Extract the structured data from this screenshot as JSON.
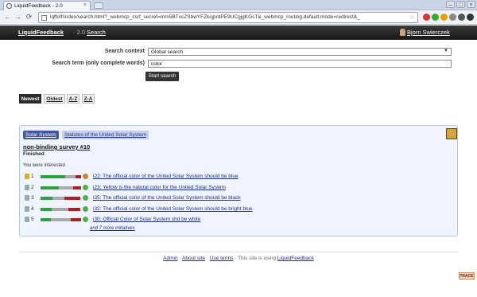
{
  "browser": {
    "tab_title": "LiquidFeedback - 2.0",
    "tab_close": "×",
    "url": "lqfb/lf/index/search.html?_webmcp_csrf_secret=mm5BTxcZSbwYFZksjprdPE9UCgjgKGsT&_webmcp_routing.default.mode=redirect&_",
    "back": "←",
    "forward": "→",
    "reload": "⟳",
    "star": "☆",
    "window_buttons": [
      "–",
      "□",
      "×"
    ]
  },
  "header": {
    "brand": "LiquidFeedback",
    "version": "· 2.0",
    "search_link": "Search",
    "user": "Bjorn Swierczek"
  },
  "search": {
    "context_label": "Search context",
    "context_value": "Global search",
    "term_label": "Search term (only complete words)",
    "term_value": "color",
    "submit": "Start search"
  },
  "sort_tabs": [
    "Newest",
    "Oldest",
    "A-Z",
    "Z-A"
  ],
  "issue": {
    "area": "Solar System",
    "policy": "Statutes of the United Solar System",
    "title": "non-binding survey #10",
    "state": "Finished",
    "interest": "You were interested",
    "initiatives": [
      {
        "rank": "1",
        "label": "i22: The official color of the United Solar System should be blue",
        "yes": 0.62,
        "neutral": 0.25,
        "no": 0.13,
        "winner": true,
        "support_color": "#c8823a"
      },
      {
        "rank": "2",
        "label": "i23: Yellow is the natural color for the United Solar System",
        "yes": 0.45,
        "neutral": 0.35,
        "no": 0.2,
        "winner": false,
        "support_color": "#4fb048"
      },
      {
        "rank": "3",
        "label": "i35: The official color of the United Solar System should be black",
        "yes": 0.3,
        "neutral": 0.3,
        "no": 0.4,
        "winner": false,
        "support_color": "#4fb048"
      },
      {
        "rank": "4",
        "label": "i32: The official color of the United Solar System should be bright blue",
        "yes": 0.28,
        "neutral": 0.42,
        "no": 0.3,
        "winner": false,
        "support_color": "#4fb048"
      },
      {
        "rank": "5",
        "label": "i30: Official Color of Solar System shd be white",
        "yes": 0.25,
        "neutral": 0.5,
        "no": 0.25,
        "winner": false,
        "support_color": "#4fb048"
      }
    ],
    "more": "and 7 more initiatives"
  },
  "footer": {
    "admin": "Admin",
    "about": "About site",
    "terms": "Use terms",
    "powered": "This site is using",
    "lf_link": "LiquidFeedback"
  },
  "trace": "TRACE"
}
